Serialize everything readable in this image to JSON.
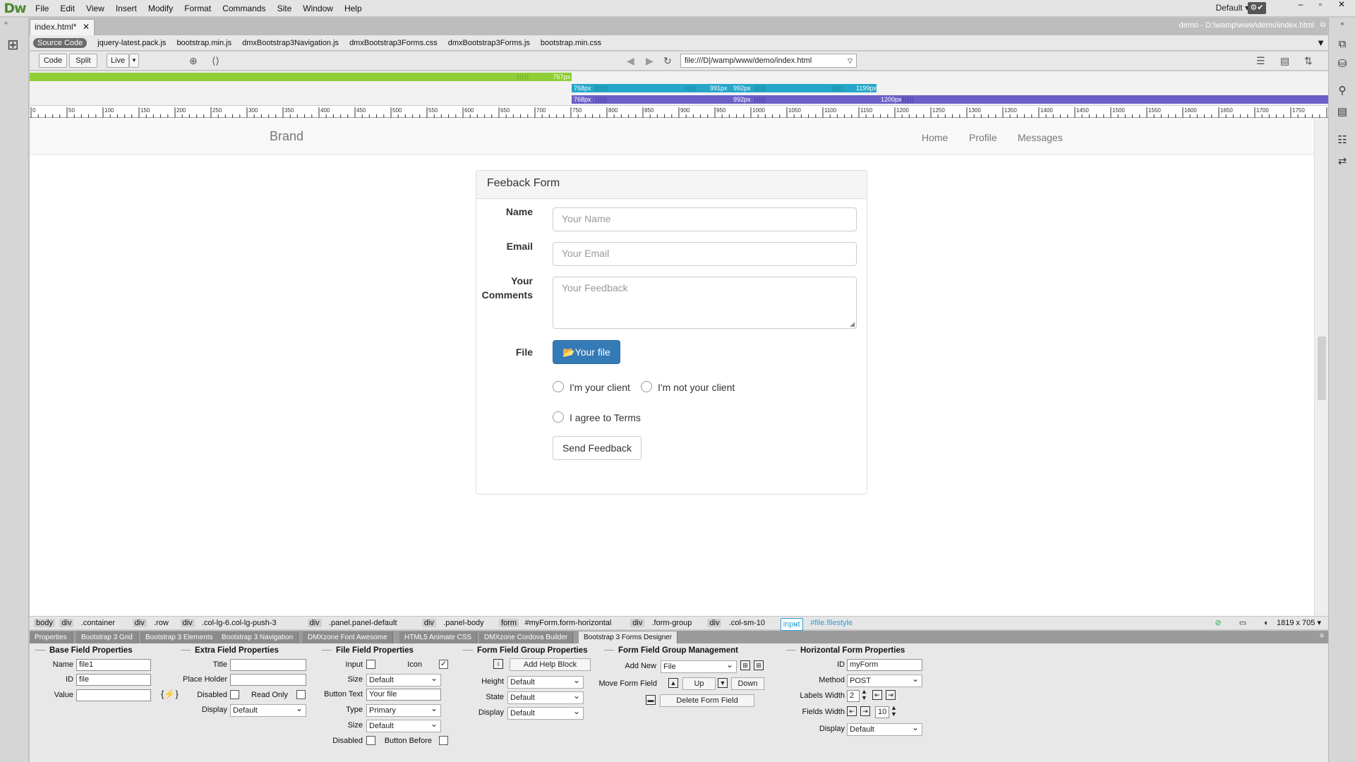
{
  "app": {
    "logo": "Dw",
    "workspace": "Default",
    "sync_label": "⚙✔"
  },
  "menu": [
    "File",
    "Edit",
    "View",
    "Insert",
    "Modify",
    "Format",
    "Commands",
    "Site",
    "Window",
    "Help"
  ],
  "document": {
    "tab_label": "index.html*",
    "path": "demo - D:\\wamp\\www\\demo\\index.html"
  },
  "related_files": [
    "Source Code",
    "jquery-latest.pack.js",
    "bootstrap.min.js",
    "dmxBootstrap3Navigation.js",
    "dmxBootstrap3Forms.css",
    "dmxBootstrap3Forms.js",
    "bootstrap.min.css"
  ],
  "toolbar": {
    "code": "Code",
    "split": "Split",
    "live": "Live",
    "address": "file:///D|/wamp/www/demo/index.html"
  },
  "media_queries": {
    "bar1": "767px",
    "bar2_start": "768px",
    "bar2_mid1": "991px",
    "bar2_mid2": "992px",
    "bar2_end": "1199px",
    "bar3_start": "768px",
    "bar3_mid": "992px",
    "bar3_end": "1200px"
  },
  "ruler": {
    "labels": [
      "0",
      "50",
      "100",
      "150",
      "200",
      "250",
      "300",
      "350",
      "400",
      "450",
      "500",
      "550",
      "600",
      "650",
      "700",
      "750",
      "800",
      "850",
      "900",
      "950",
      "1000",
      "1050",
      "1100",
      "1150",
      "1200",
      "1250",
      "1300",
      "1350",
      "1400",
      "1450",
      "1500",
      "1550",
      "1600",
      "1650",
      "1700",
      "1750",
      "18"
    ]
  },
  "page": {
    "brand": "Brand",
    "nav": [
      "Home",
      "Profile",
      "Messages"
    ],
    "form": {
      "title": "Feeback Form",
      "name_label": "Name",
      "name_placeholder": "Your Name",
      "email_label": "Email",
      "email_placeholder": "Your Email",
      "comments_label_1": "Your",
      "comments_label_2": "Comments",
      "comments_placeholder": "Your Feedback",
      "file_label": "File",
      "file_button": "Your file",
      "radio1": "I'm your client",
      "radio2": "I'm not your client",
      "agree": "I agree to Terms",
      "submit": "Send Feedback"
    }
  },
  "tag_selector": [
    {
      "tag": "body",
      "cls": ""
    },
    {
      "tag": "div",
      "cls": ".container"
    },
    {
      "tag": "div",
      "cls": ".row"
    },
    {
      "tag": "div",
      "cls": ".col-lg-6.col-lg-push-3"
    },
    {
      "tag": "div",
      "cls": ".panel.panel-default"
    },
    {
      "tag": "div",
      "cls": ".panel-body"
    },
    {
      "tag": "form",
      "cls": "#myForm.form-horizontal"
    },
    {
      "tag": "div",
      "cls": ".form-group"
    },
    {
      "tag": "div",
      "cls": ".col-sm-10"
    },
    {
      "tag": "input",
      "cls": "#file.filestyle"
    }
  ],
  "window_size": "1819 x 705",
  "panel_tabs": [
    "Properties",
    "Bootstrap 3 Grid",
    "Bootstrap 3 Elements",
    "Bootstrap 3 Navigation",
    "DMXzone Font Awesome",
    "HTML5 Animate CSS",
    "DMXzone Cordova Builder",
    "Bootstrap 3 Forms Designer"
  ],
  "props": {
    "base": {
      "title": "Base Field Properties",
      "name_label": "Name",
      "name": "file1",
      "id_label": "ID",
      "id": "file",
      "value_label": "Value",
      "value": ""
    },
    "extra": {
      "title": "Extra Field Properties",
      "title_label": "Title",
      "placeholder_label": "Place Holder",
      "disabled_label": "Disabled",
      "readonly_label": "Read Only",
      "display_label": "Display",
      "display": "Default"
    },
    "file": {
      "title": "File Field Properties",
      "input_label": "Input",
      "icon_label": "Icon",
      "size_label": "Size",
      "size": "Default",
      "btn_text_label": "Button Text",
      "btn_text": "Your file",
      "type_label": "Type",
      "type": "Primary",
      "size2_label": "Size",
      "size2": "Default",
      "disabled_label": "Disabled",
      "before_label": "Button Before"
    },
    "group": {
      "title": "Form Field Group Properties",
      "help_btn": "Add Help Block",
      "height_label": "Height",
      "height": "Default",
      "state_label": "State",
      "state": "Default",
      "display_label": "Display",
      "display": "Default"
    },
    "mgmt": {
      "title": "Form Field Group Management",
      "addnew_label": "Add New",
      "addnew": "File",
      "move_label": "Move Form Field",
      "up": "Up",
      "down": "Down",
      "delete": "Delete Form Field"
    },
    "horiz": {
      "title": "Horizontal Form Properties",
      "id_label": "ID",
      "id": "myForm",
      "method_label": "Method",
      "method": "POST",
      "labels_label": "Labels Width",
      "labels": "2",
      "fields_label": "Fields Width",
      "fields": "10",
      "display_label": "Display",
      "display": "Default"
    }
  }
}
